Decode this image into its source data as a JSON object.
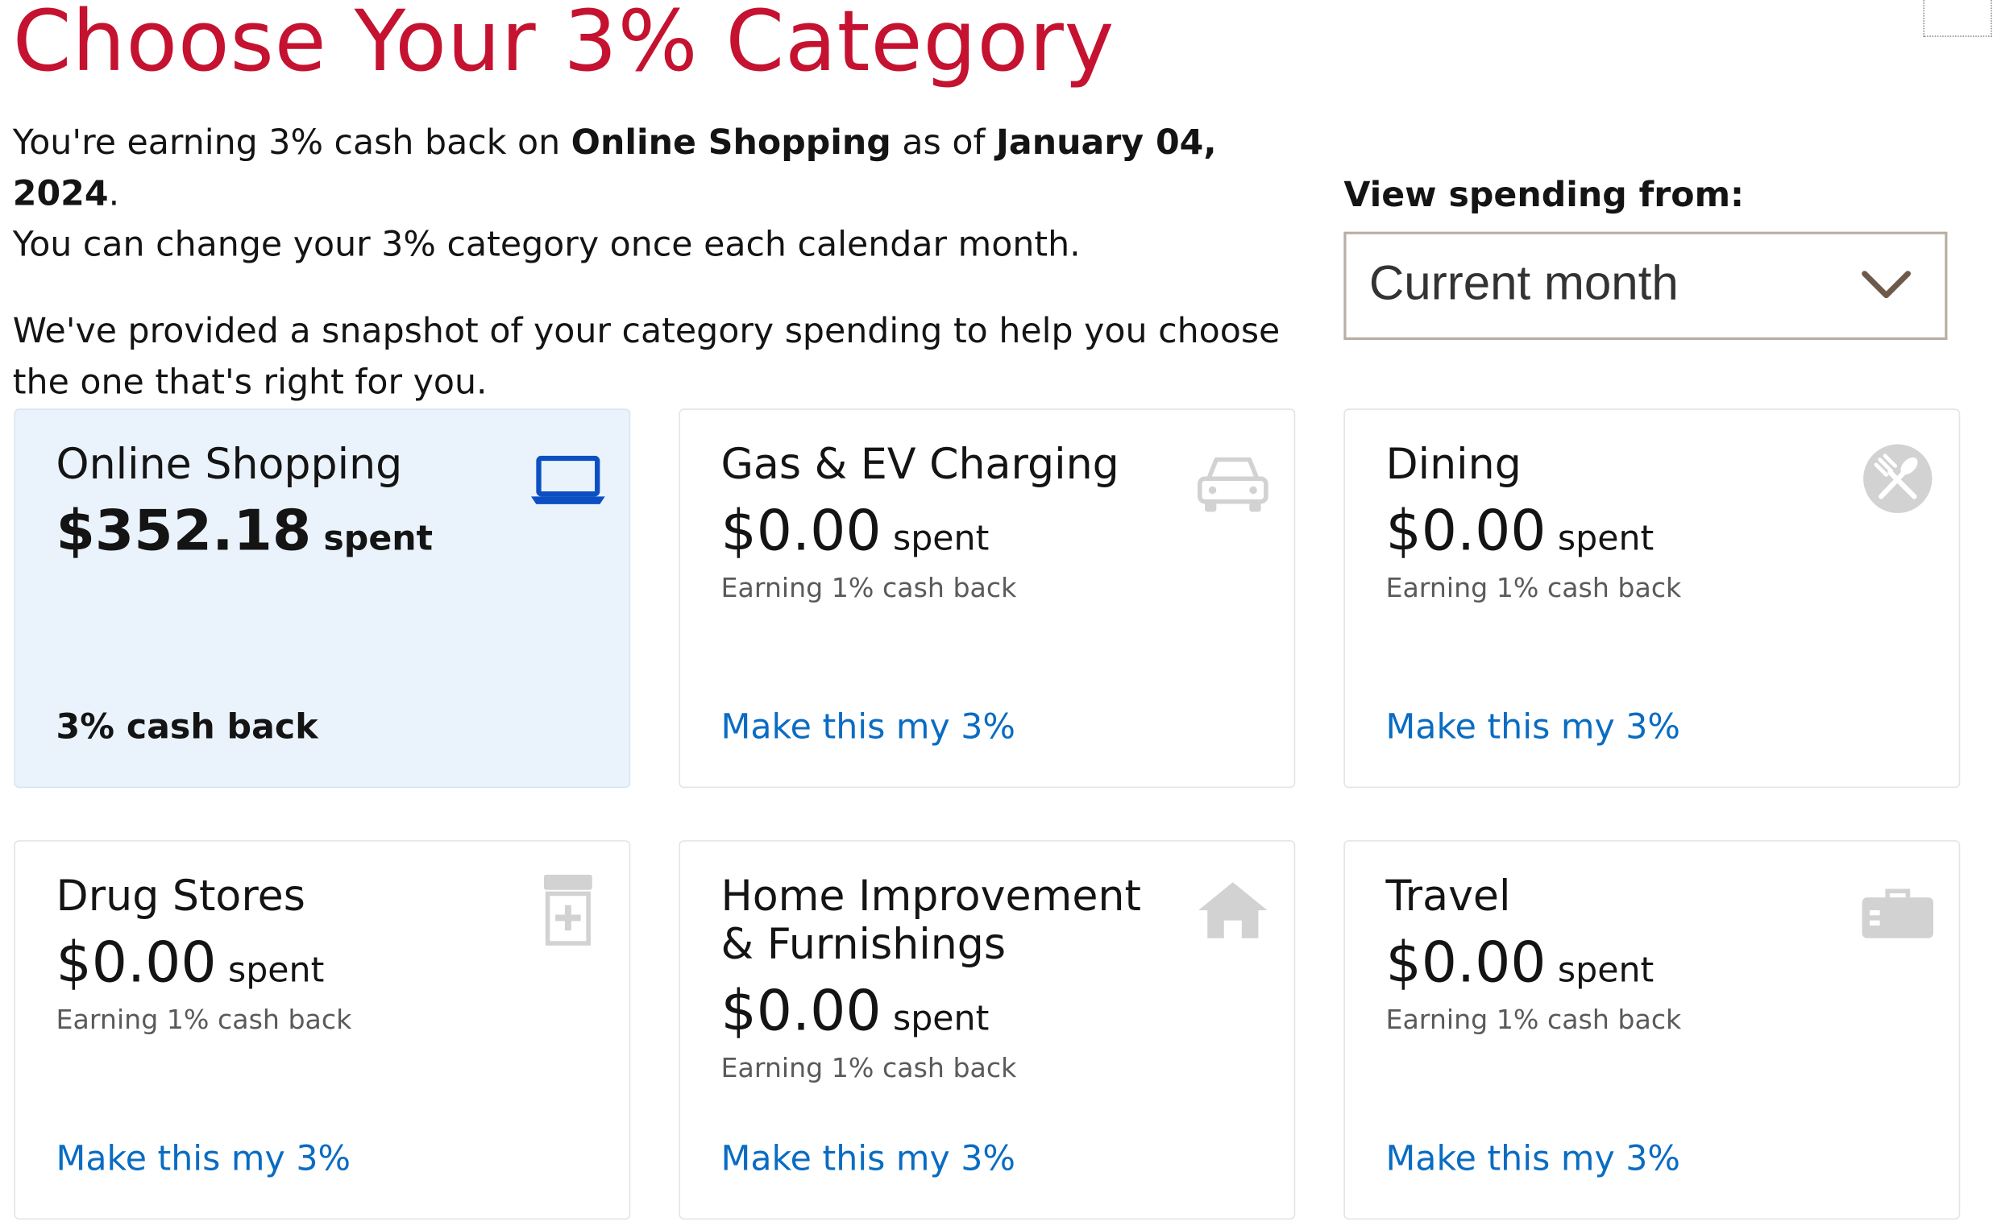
{
  "header": {
    "title": "Choose Your 3% Category",
    "intro": {
      "line1_prefix": "You're earning 3% cash back on ",
      "current_category": "Online Shopping",
      "line1_mid": " as of ",
      "as_of_date": "January 04, 2024",
      "line1_suffix": ".",
      "line2": "You can change your 3% category once each calendar month.",
      "paragraph2": "We've provided a snapshot of your category spending to help you choose the one that's right for you."
    }
  },
  "spending_filter": {
    "label": "View spending from:",
    "selected": "Current month"
  },
  "categories": [
    {
      "name": "Online Shopping",
      "amount": "$352.18",
      "spent_label": "spent",
      "status": "3% cash back",
      "icon": "laptop-icon",
      "selected": true
    },
    {
      "name": "Gas & EV Charging",
      "amount": "$0.00",
      "spent_label": "spent",
      "earning": "Earning 1% cash back",
      "action": "Make this my 3%",
      "icon": "car-icon"
    },
    {
      "name": "Dining",
      "amount": "$0.00",
      "spent_label": "spent",
      "earning": "Earning 1% cash back",
      "action": "Make this my 3%",
      "icon": "utensils-icon"
    },
    {
      "name": "Drug Stores",
      "amount": "$0.00",
      "spent_label": "spent",
      "earning": "Earning 1% cash back",
      "action": "Make this my 3%",
      "icon": "pill-bottle-icon"
    },
    {
      "name": "Home Improvement & Furnishings",
      "amount": "$0.00",
      "spent_label": "spent",
      "earning": "Earning 1% cash back",
      "action": "Make this my 3%",
      "icon": "house-icon"
    },
    {
      "name": "Travel",
      "amount": "$0.00",
      "spent_label": "spent",
      "earning": "Earning 1% cash back",
      "action": "Make this my 3%",
      "icon": "suitcase-icon"
    }
  ],
  "colors": {
    "title_red": "#c41230",
    "link_blue": "#0a6cc2",
    "selected_card_bg": "#eaf3fb",
    "selected_icon_blue": "#0b4fc2",
    "inactive_icon_gray": "#d2d2d2"
  }
}
